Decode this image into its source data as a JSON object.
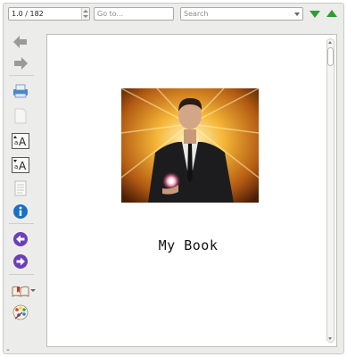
{
  "toolbar": {
    "page_value": "1.0 / 182",
    "goto_placeholder": "Go to...",
    "search_placeholder": "Search"
  },
  "sidebar": {
    "items": [
      {
        "name": "back-arrow-icon"
      },
      {
        "name": "forward-arrow-icon"
      },
      {
        "name": "print-icon"
      },
      {
        "name": "blank-page-icon"
      },
      {
        "name": "font-size-increase-icon"
      },
      {
        "name": "font-size-decrease-icon"
      },
      {
        "name": "document-page-icon"
      },
      {
        "name": "info-icon"
      },
      {
        "name": "previous-section-icon"
      },
      {
        "name": "next-section-icon"
      },
      {
        "name": "book-reference-icon"
      },
      {
        "name": "color-palette-icon"
      }
    ]
  },
  "document": {
    "title": "My Book"
  },
  "colors": {
    "nav_green": "#2f9c2f",
    "info_blue": "#1a6fc4",
    "purple_nav": "#6a3fb8"
  }
}
